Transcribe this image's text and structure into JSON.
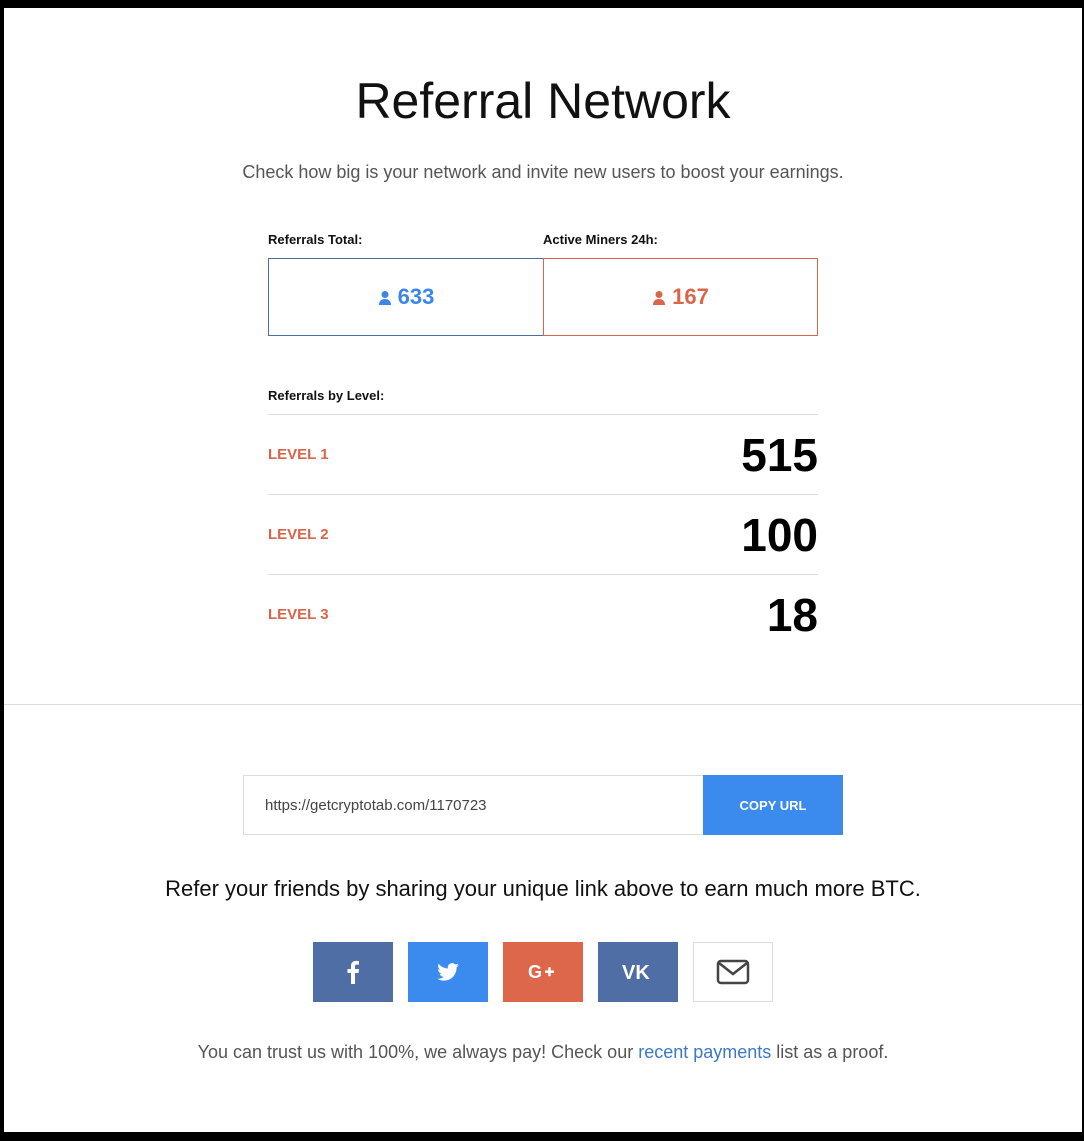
{
  "header": {
    "title": "Referral Network",
    "subtitle": "Check how big is your network and invite new users to boost your earnings."
  },
  "stats": {
    "total_label": "Referrals Total:",
    "total_value": "633",
    "active_label": "Active Miners 24h:",
    "active_value": "167",
    "total_color": "#3b87e8",
    "active_color": "#d9654a"
  },
  "levels": {
    "label": "Referrals by Level:",
    "items": [
      {
        "name": "LEVEL 1",
        "value": "515"
      },
      {
        "name": "LEVEL 2",
        "value": "100"
      },
      {
        "name": "LEVEL 3",
        "value": "18"
      }
    ]
  },
  "share": {
    "url": "https://getcryptotab.com/1170723",
    "copy_label": "COPY URL",
    "refer_text": "Refer your friends by sharing your unique link above to earn much more BTC.",
    "buttons": [
      {
        "icon": "facebook-icon",
        "color": "#4f6ea5"
      },
      {
        "icon": "twitter-icon",
        "color": "#3b8aee"
      },
      {
        "icon": "google-plus-icon",
        "color": "#dd674b"
      },
      {
        "icon": "vk-icon",
        "color": "#4f6ea5"
      },
      {
        "icon": "email-icon",
        "color": "#ffffff"
      }
    ]
  },
  "trust": {
    "before": "You can trust us with 100%, we always pay! Check our ",
    "link": "recent payments",
    "after": " list as a proof."
  }
}
